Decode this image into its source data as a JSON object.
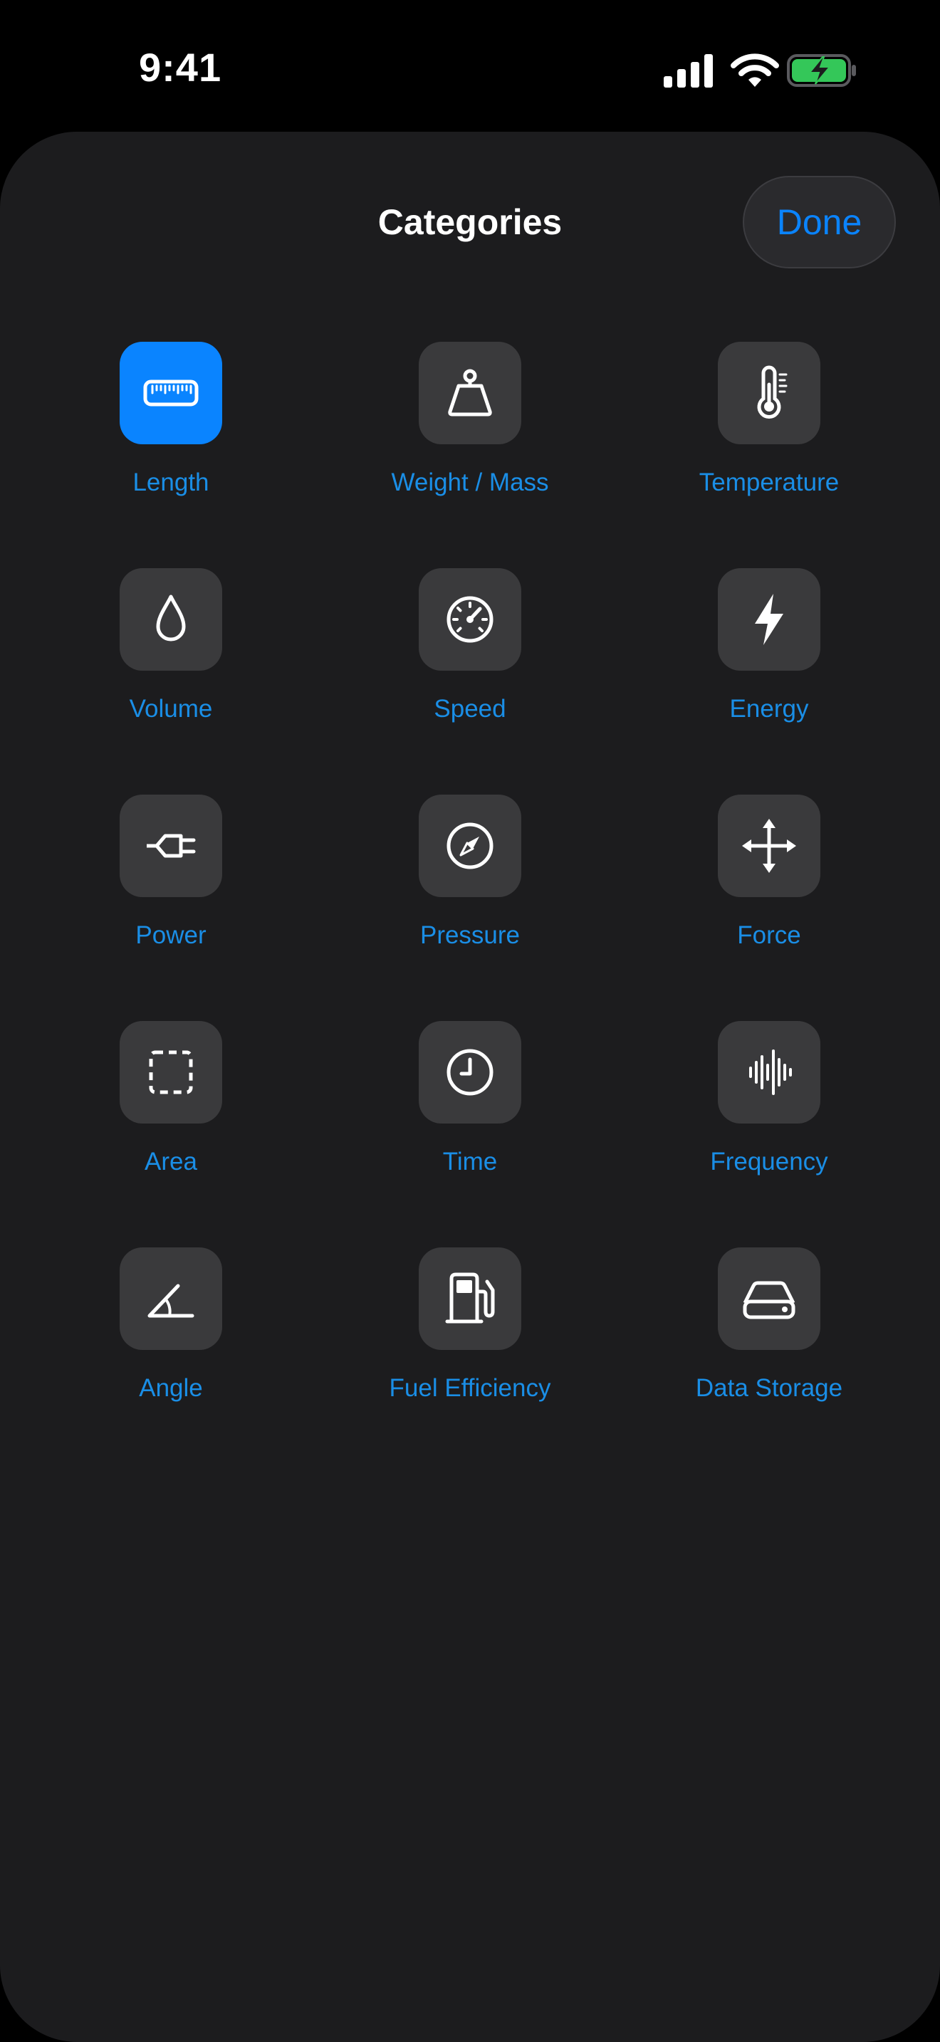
{
  "status_bar": {
    "time": "9:41",
    "signal_icon": "cellular-signal-icon",
    "wifi_icon": "wifi-icon",
    "battery_icon": "battery-charging-icon",
    "battery_color": "#34c759"
  },
  "sheet": {
    "title": "Categories",
    "done_label": "Done"
  },
  "colors": {
    "accent": "#0a84ff",
    "tile_background": "#3a3a3c",
    "sheet_background": "#1c1c1e"
  },
  "categories": [
    {
      "label": "Length",
      "icon": "ruler-icon",
      "selected": true
    },
    {
      "label": "Weight / Mass",
      "icon": "weight-icon",
      "selected": false
    },
    {
      "label": "Temperature",
      "icon": "thermometer-icon",
      "selected": false
    },
    {
      "label": "Volume",
      "icon": "drop-icon",
      "selected": false
    },
    {
      "label": "Speed",
      "icon": "speedometer-icon",
      "selected": false
    },
    {
      "label": "Energy",
      "icon": "bolt-icon",
      "selected": false
    },
    {
      "label": "Power",
      "icon": "plug-icon",
      "selected": false
    },
    {
      "label": "Pressure",
      "icon": "gauge-icon",
      "selected": false
    },
    {
      "label": "Force",
      "icon": "move-arrows-icon",
      "selected": false
    },
    {
      "label": "Area",
      "icon": "dashed-square-icon",
      "selected": false
    },
    {
      "label": "Time",
      "icon": "clock-icon",
      "selected": false
    },
    {
      "label": "Frequency",
      "icon": "waveform-icon",
      "selected": false
    },
    {
      "label": "Angle",
      "icon": "angle-icon",
      "selected": false
    },
    {
      "label": "Fuel Efficiency",
      "icon": "fuel-pump-icon",
      "selected": false
    },
    {
      "label": "Data Storage",
      "icon": "drive-icon",
      "selected": false
    }
  ]
}
